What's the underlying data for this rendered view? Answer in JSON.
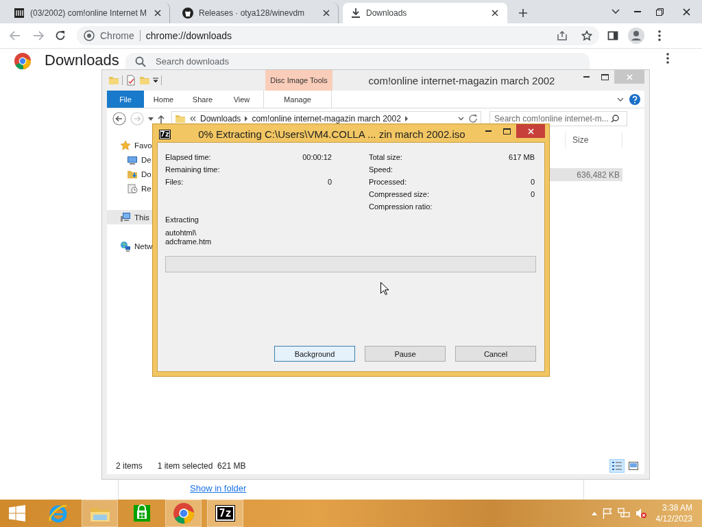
{
  "browser": {
    "tabs": [
      {
        "title": "(03/2002) com!online Internet M",
        "selected": false
      },
      {
        "title": "Releases · otya128/winevdm",
        "selected": false
      },
      {
        "title": "Downloads",
        "selected": true
      }
    ],
    "omnibox": {
      "site_label": "Chrome",
      "url": "chrome://downloads"
    }
  },
  "downloads_page": {
    "heading": "Downloads",
    "search": {
      "placeholder": "Search downloads"
    },
    "show_in_folder_link": "Show in folder"
  },
  "explorer": {
    "title": "com!online internet-magazin march 2002",
    "context_tab_group": "Disc Image Tools",
    "ribbon_tabs": [
      {
        "label": "File",
        "kind": "backstage"
      },
      {
        "label": "Home",
        "kind": "tab"
      },
      {
        "label": "Share",
        "kind": "tab"
      },
      {
        "label": "View",
        "kind": "tab"
      },
      {
        "label": "Manage",
        "kind": "contextual"
      }
    ],
    "breadcrumb": [
      "Downloads",
      "com!online internet-magazin march 2002"
    ],
    "search": {
      "placeholder": "Search com!online internet-m..."
    },
    "navigation": [
      {
        "label": "Favo",
        "selected": false,
        "children": [
          {
            "label": "De",
            "selected": false
          },
          {
            "label": "Do",
            "selected": false
          },
          {
            "label": "Re",
            "selected": false
          }
        ]
      },
      {
        "label": "This",
        "selected": true
      },
      {
        "label": "Netw",
        "selected": false
      }
    ],
    "columns": [
      "Size"
    ],
    "rows": [
      {
        "size": "636,482 KB",
        "selected": true
      }
    ],
    "status": {
      "item_count": "2 items",
      "selection": "1 item selected  621 MB"
    },
    "view_buttons": [
      {
        "kind": "details",
        "selected": true
      },
      {
        "kind": "tiles",
        "selected": false
      }
    ]
  },
  "extract_dialog": {
    "app_badge": "7z",
    "title": "0% Extracting C:\\Users\\VM4.COLLA ... zin march 2002.iso",
    "stats_left": [
      {
        "label": "Elapsed time:",
        "value": "00:00:12"
      },
      {
        "label": "Remaining time:"
      },
      {
        "label": "Files:",
        "value": "0"
      }
    ],
    "stats_right": [
      {
        "label": "Total size:",
        "value": "617 MB"
      },
      {
        "label": "Speed:"
      },
      {
        "label": "Processed:",
        "value": "0"
      },
      {
        "label": "Compressed size:",
        "value": "0"
      },
      {
        "label": "Compression ratio:"
      }
    ],
    "current_label": "Extracting",
    "current_file": [
      "autohtml\\",
      "adcframe.htm"
    ],
    "progress": {
      "level": 0
    },
    "buttons": [
      {
        "label": "Background",
        "default": true
      },
      {
        "label": "Pause",
        "default": false
      },
      {
        "label": "Cancel",
        "default": false
      }
    ]
  },
  "taskbar": {
    "buttons": [
      {
        "kind": "start",
        "running": false
      },
      {
        "kind": "ie",
        "running": false
      },
      {
        "kind": "explorer",
        "running": true
      },
      {
        "kind": "store",
        "running": false
      },
      {
        "kind": "chrome",
        "running": true
      },
      {
        "kind": "sevenzip",
        "badge": "7z",
        "running": true
      }
    ],
    "clock": {
      "time": "3:38 AM",
      "date": "4/12/2023"
    }
  }
}
